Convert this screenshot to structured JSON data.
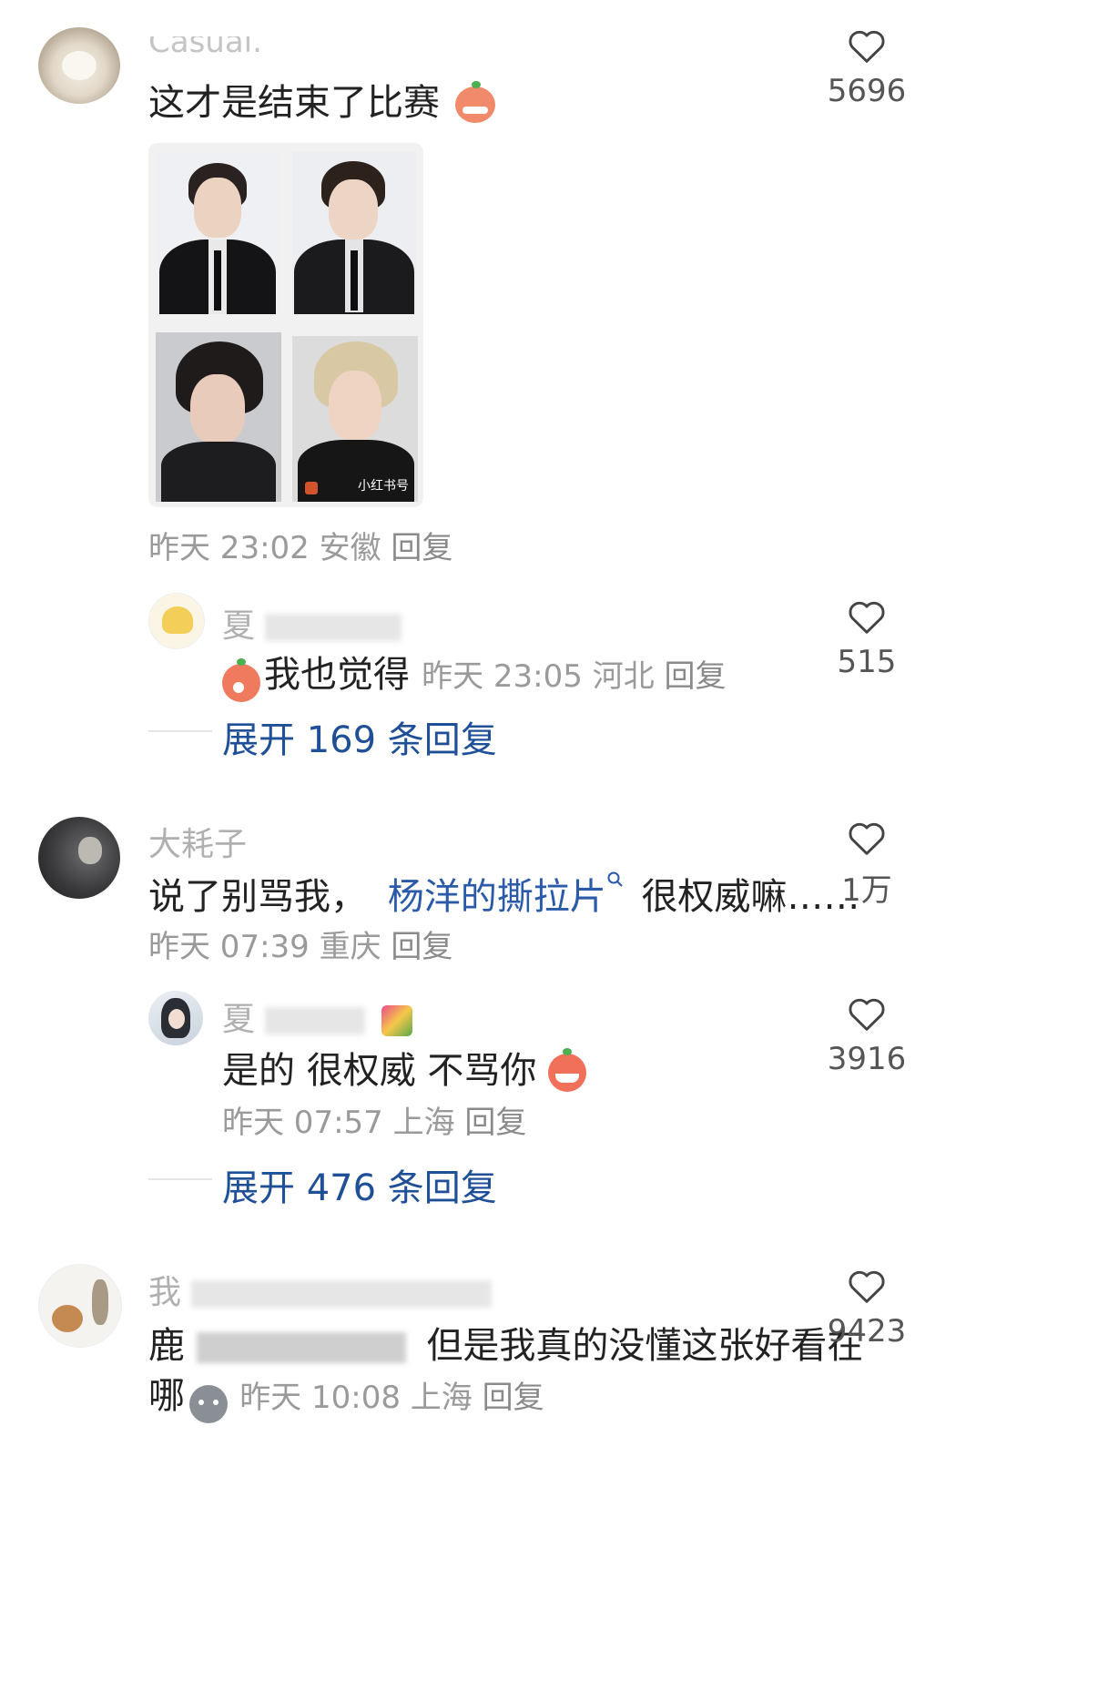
{
  "comments": [
    {
      "username": "Casual.",
      "text": "这才是结束了比赛",
      "meta": {
        "time": "昨天 23:02",
        "location": "安徽",
        "reply": "回复"
      },
      "likes": "5696",
      "photo_watermark": "小红书号",
      "sub_reply": {
        "username_visible": "夏",
        "text": "我也觉得",
        "meta": {
          "time": "昨天 23:05",
          "location": "河北",
          "reply": "回复"
        },
        "likes": "515"
      },
      "expand": "展开 169 条回复"
    },
    {
      "username": "大耗子",
      "text_prefix": "说了别骂我，",
      "text_link": "杨洋的撕拉片",
      "text_suffix": "很权威嘛……",
      "meta": {
        "time": "昨天 07:39",
        "location": "重庆",
        "reply": "回复"
      },
      "likes": "1万",
      "sub_reply": {
        "username_visible": "夏",
        "text": "是的 很权威 不骂你",
        "meta": {
          "time": "昨天 07:57",
          "location": "上海",
          "reply": "回复"
        },
        "likes": "3916"
      },
      "expand": "展开 476 条回复"
    },
    {
      "username_visible": "我",
      "text_prefix": "鹿",
      "text_main": "但是我真的没懂这张好看在",
      "text_line2": "哪",
      "meta": {
        "time": "昨天 10:08",
        "location": "上海",
        "reply": "回复"
      },
      "likes": "9423"
    }
  ],
  "colors": {
    "link": "#2a5aa8",
    "expand": "#1f4f96",
    "meta": "#9a9a9a"
  }
}
